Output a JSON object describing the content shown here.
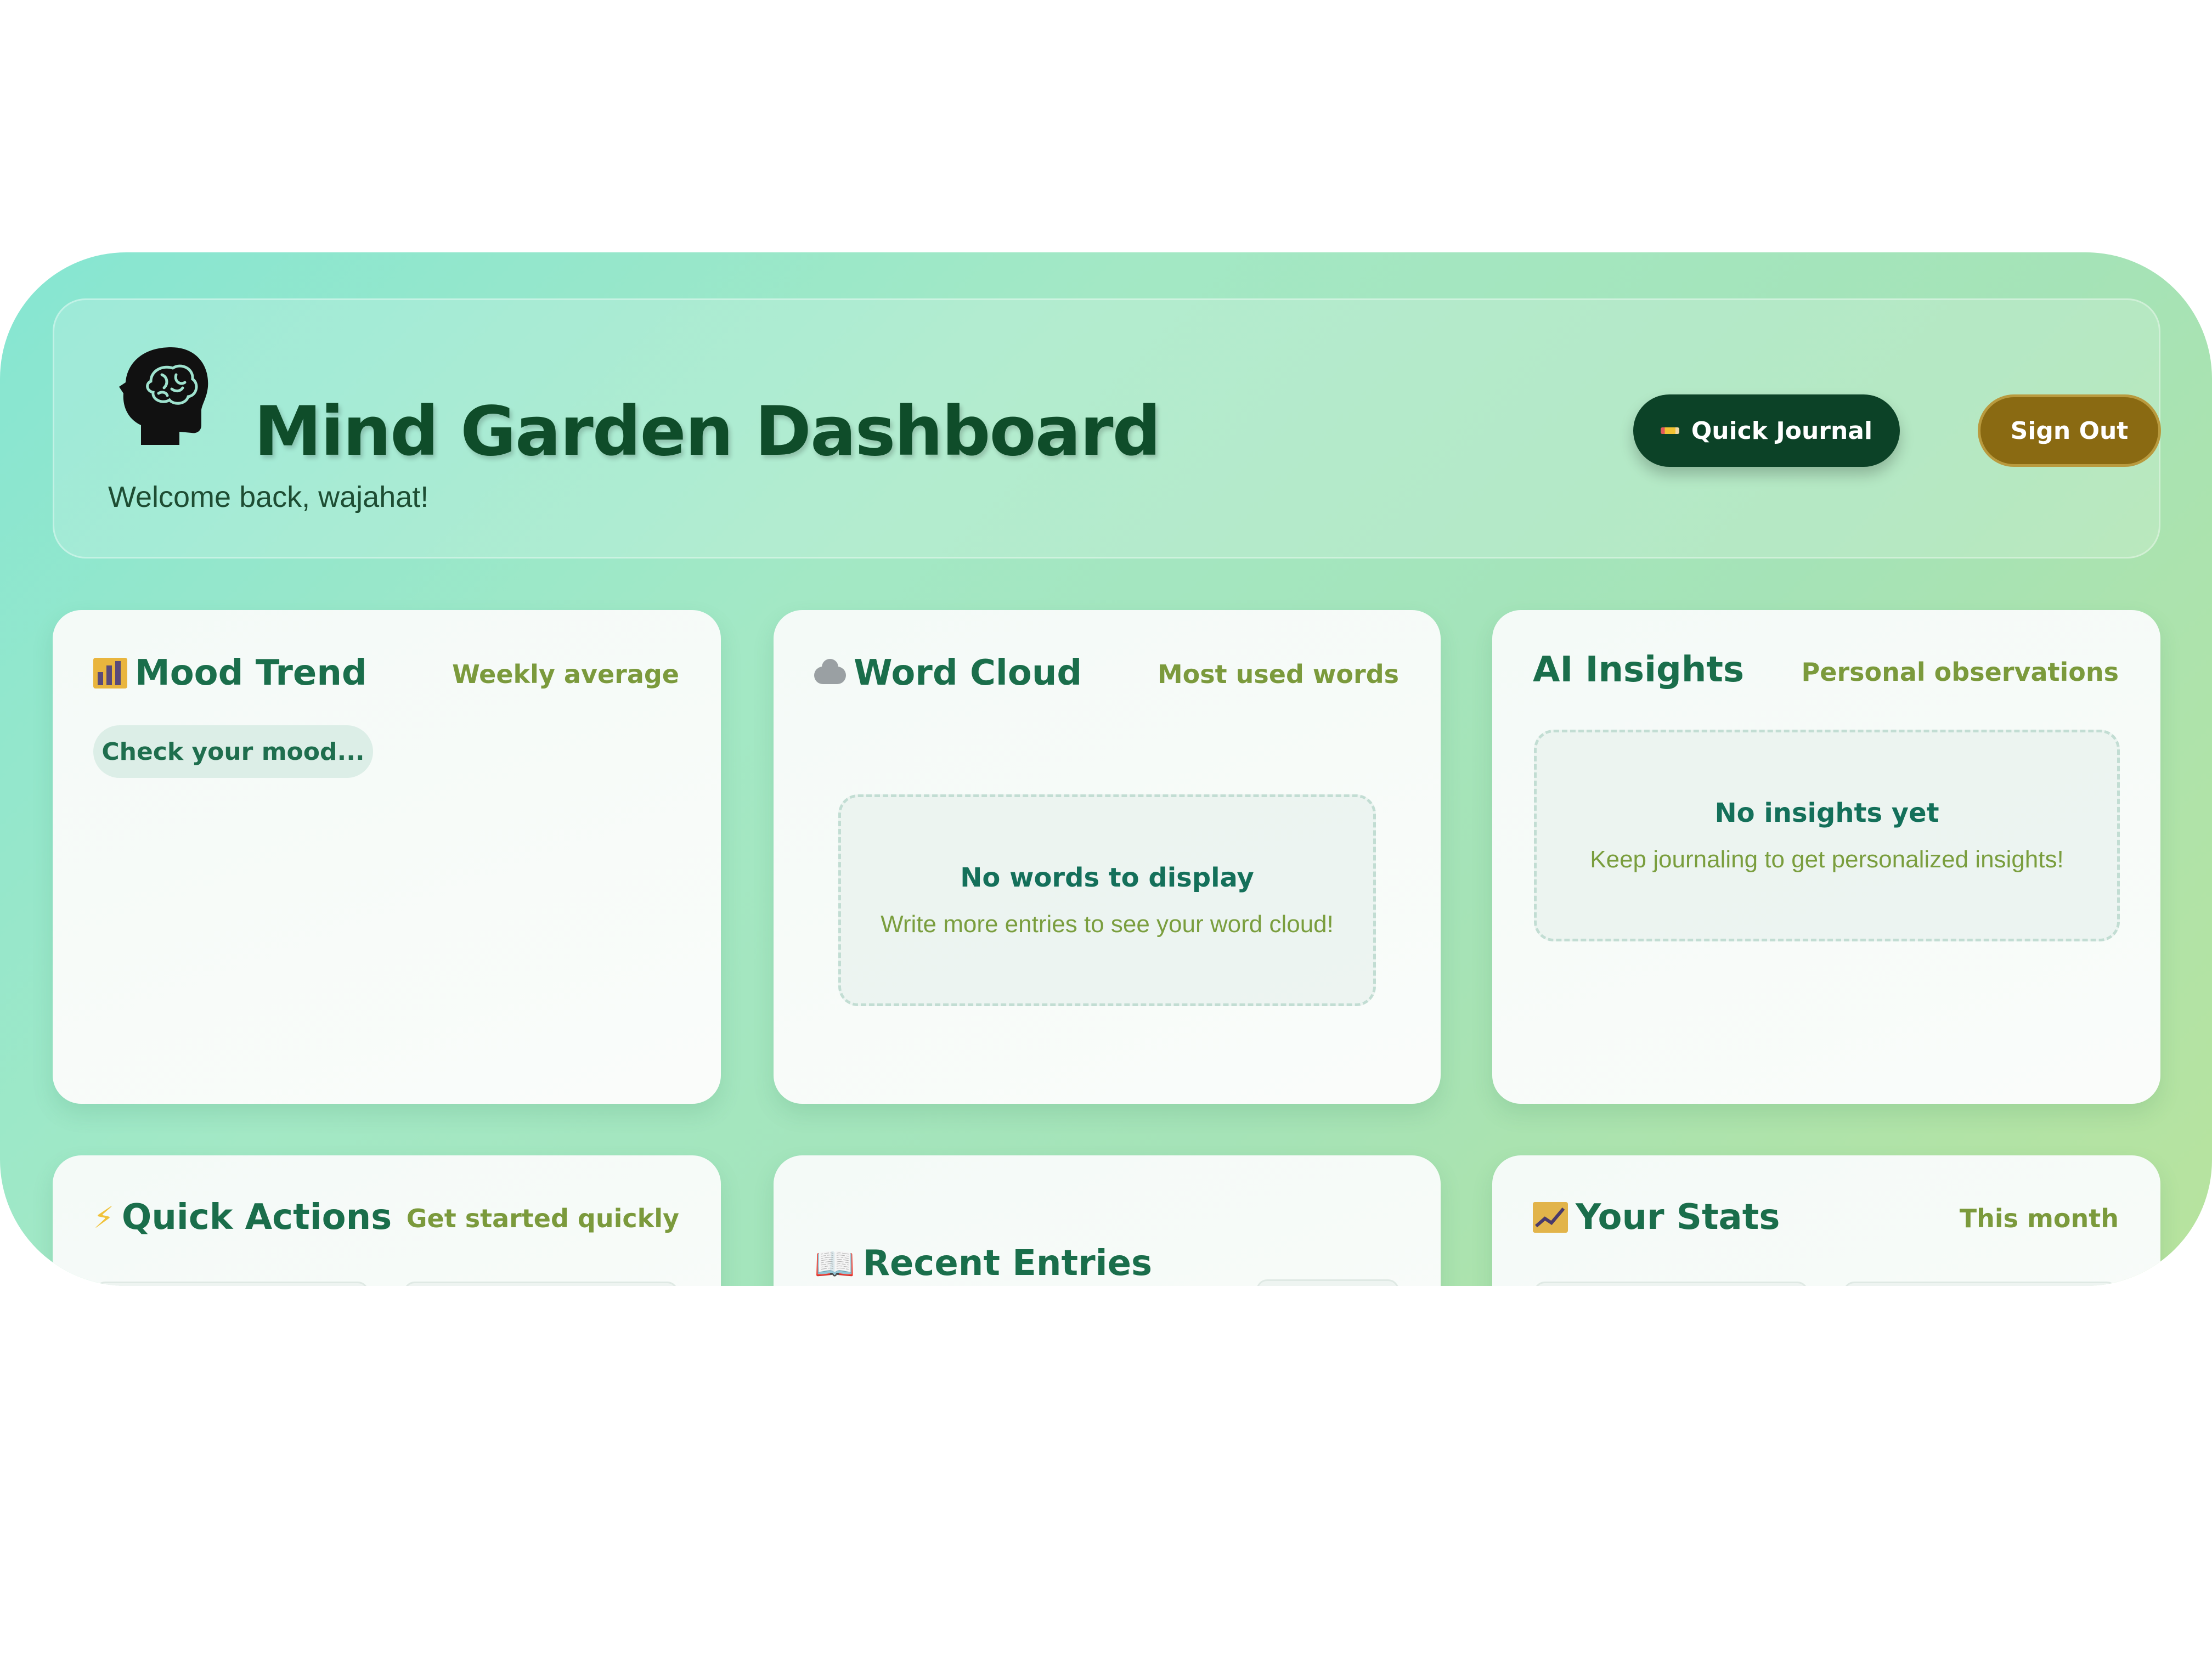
{
  "header": {
    "title": "Mind Garden Dashboard",
    "welcome": "Welcome back, wajahat!",
    "quick_journal_label": "Quick Journal",
    "sign_out_label": "Sign Out"
  },
  "cards": {
    "mood": {
      "title": "Mood Trend",
      "subtitle": "Weekly average",
      "chip": "Check your mood...",
      "icon": "bar-chart-icon"
    },
    "word_cloud": {
      "title": "Word Cloud",
      "subtitle": "Most used words",
      "empty_title": "No words to display",
      "empty_sub": "Write more entries to see your word cloud!",
      "icon": "cloud-icon"
    },
    "ai": {
      "title": "AI Insights",
      "subtitle": "Personal observations",
      "empty_title": "No insights yet",
      "empty_sub": "Keep journaling to get personalized insights!"
    },
    "quick_actions": {
      "title": "Quick Actions",
      "subtitle": "Get started quickly",
      "icon": "lightning-icon"
    },
    "recent": {
      "title": "Recent Entries",
      "icon": "book-icon"
    },
    "stats": {
      "title": "Your Stats",
      "subtitle": "This month",
      "icon": "trend-chart-icon"
    }
  },
  "colors": {
    "brand_dark": "#0c4227",
    "sign_out": "#8a6a12",
    "title_green": "#1a6e4b",
    "accent_olive": "#7b9a3c"
  }
}
